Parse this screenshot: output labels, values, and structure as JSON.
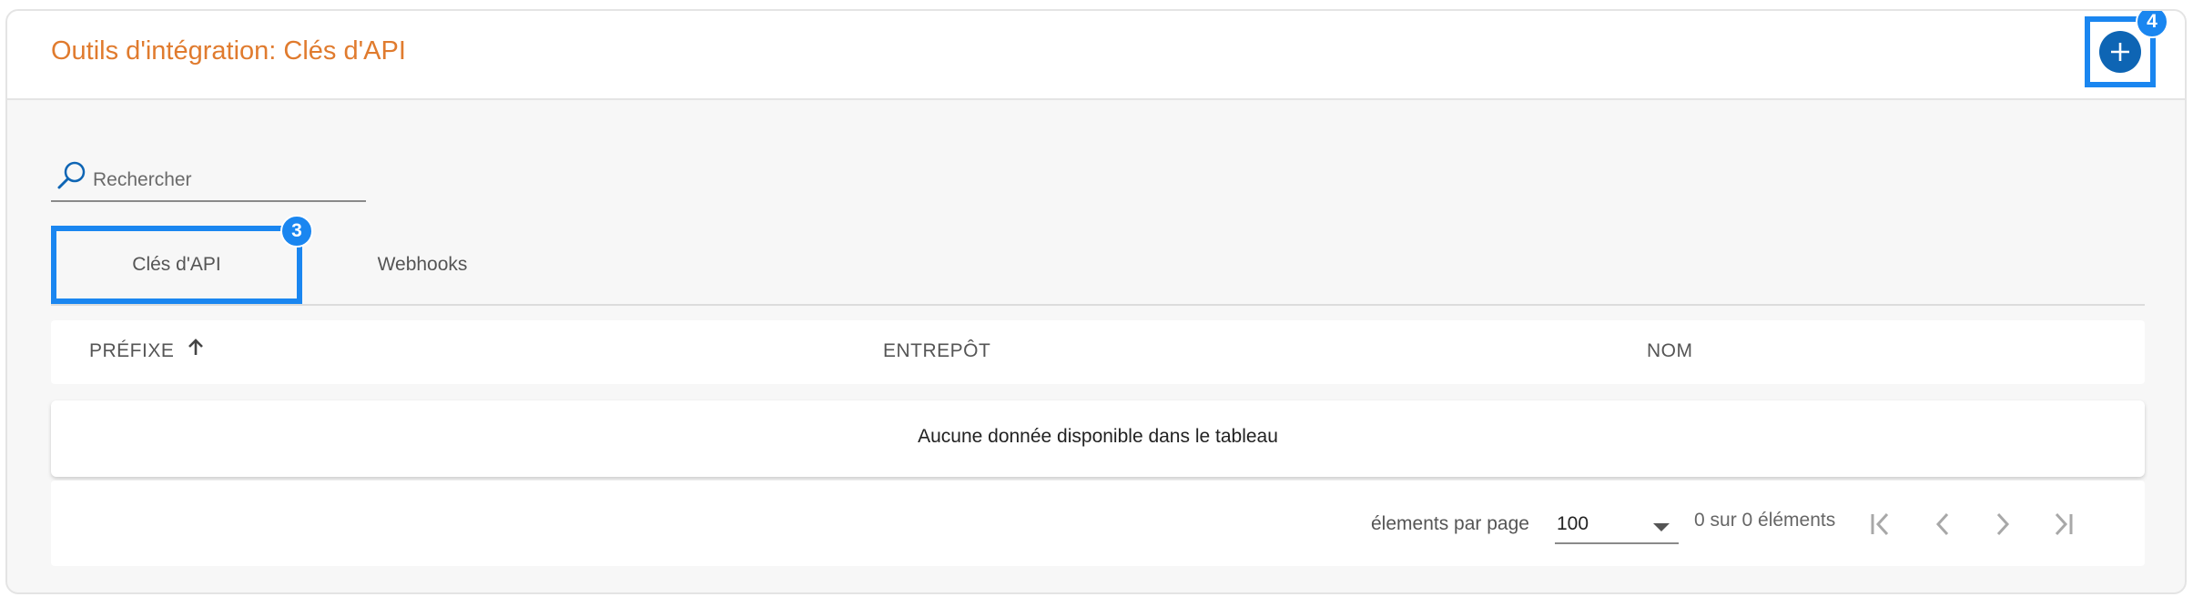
{
  "header": {
    "title": "Outils d'intégration: Clés d'API",
    "add_badge": "4"
  },
  "search": {
    "placeholder": "Rechercher",
    "value": ""
  },
  "tabs": [
    {
      "label": "Clés d'API",
      "active": true,
      "badge": "3"
    },
    {
      "label": "Webhooks",
      "active": false
    }
  ],
  "table": {
    "columns": [
      "PRÉFIXE",
      "ENTREPÔT",
      "NOM"
    ],
    "sort_column": "PRÉFIXE",
    "sort_direction": "ascending",
    "empty_message": "Aucune donnée disponible dans le tableau"
  },
  "pagination": {
    "per_page_label": "élements par page",
    "per_page_value": "100",
    "range_text": "0 sur 0 éléments"
  },
  "colors": {
    "title": "#e07b2e",
    "primary_button": "#0e65b4",
    "highlight": "#1a86f0"
  },
  "icons": {
    "add": "plus-icon",
    "search": "search-icon",
    "sort": "arrow-up-icon",
    "dropdown": "chevron-down-icon",
    "first": "first-page-icon",
    "prev": "chevron-left-icon",
    "next": "chevron-right-icon",
    "last": "last-page-icon"
  }
}
